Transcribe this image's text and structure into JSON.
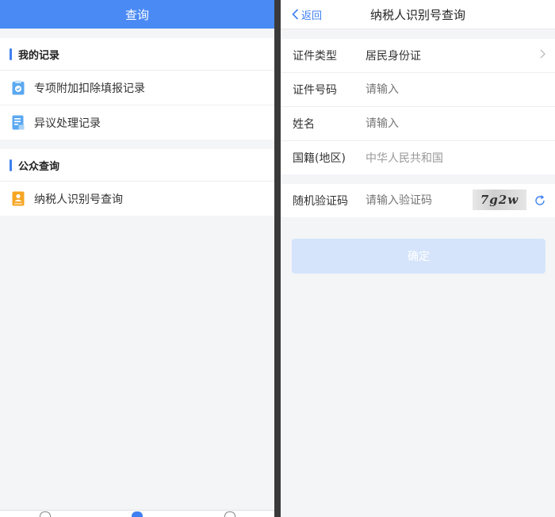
{
  "left": {
    "title": "查询",
    "sections": [
      {
        "title": "我的记录",
        "items": [
          {
            "label": "专项附加扣除填报记录",
            "icon": "clipboard-check-icon"
          },
          {
            "label": "异议处理记录",
            "icon": "document-list-icon"
          }
        ]
      },
      {
        "title": "公众查询",
        "items": [
          {
            "label": "纳税人识别号查询",
            "icon": "person-card-icon"
          }
        ]
      }
    ]
  },
  "right": {
    "back_label": "返回",
    "title": "纳税人识别号查询",
    "fields": {
      "id_type": {
        "label": "证件类型",
        "value": "居民身份证"
      },
      "id_number": {
        "label": "证件号码",
        "placeholder": "请输入"
      },
      "name": {
        "label": "姓名",
        "placeholder": "请输入"
      },
      "nationality": {
        "label": "国籍(地区)",
        "value": "中华人民共和国"
      }
    },
    "captcha": {
      "label": "随机验证码",
      "placeholder": "请输入验证码",
      "image_text": "7g2w"
    },
    "confirm_label": "确定"
  },
  "colors": {
    "primary": "#4a8af4",
    "accent": "#3d7ff0",
    "disabled_button": "#d5e4fb"
  }
}
